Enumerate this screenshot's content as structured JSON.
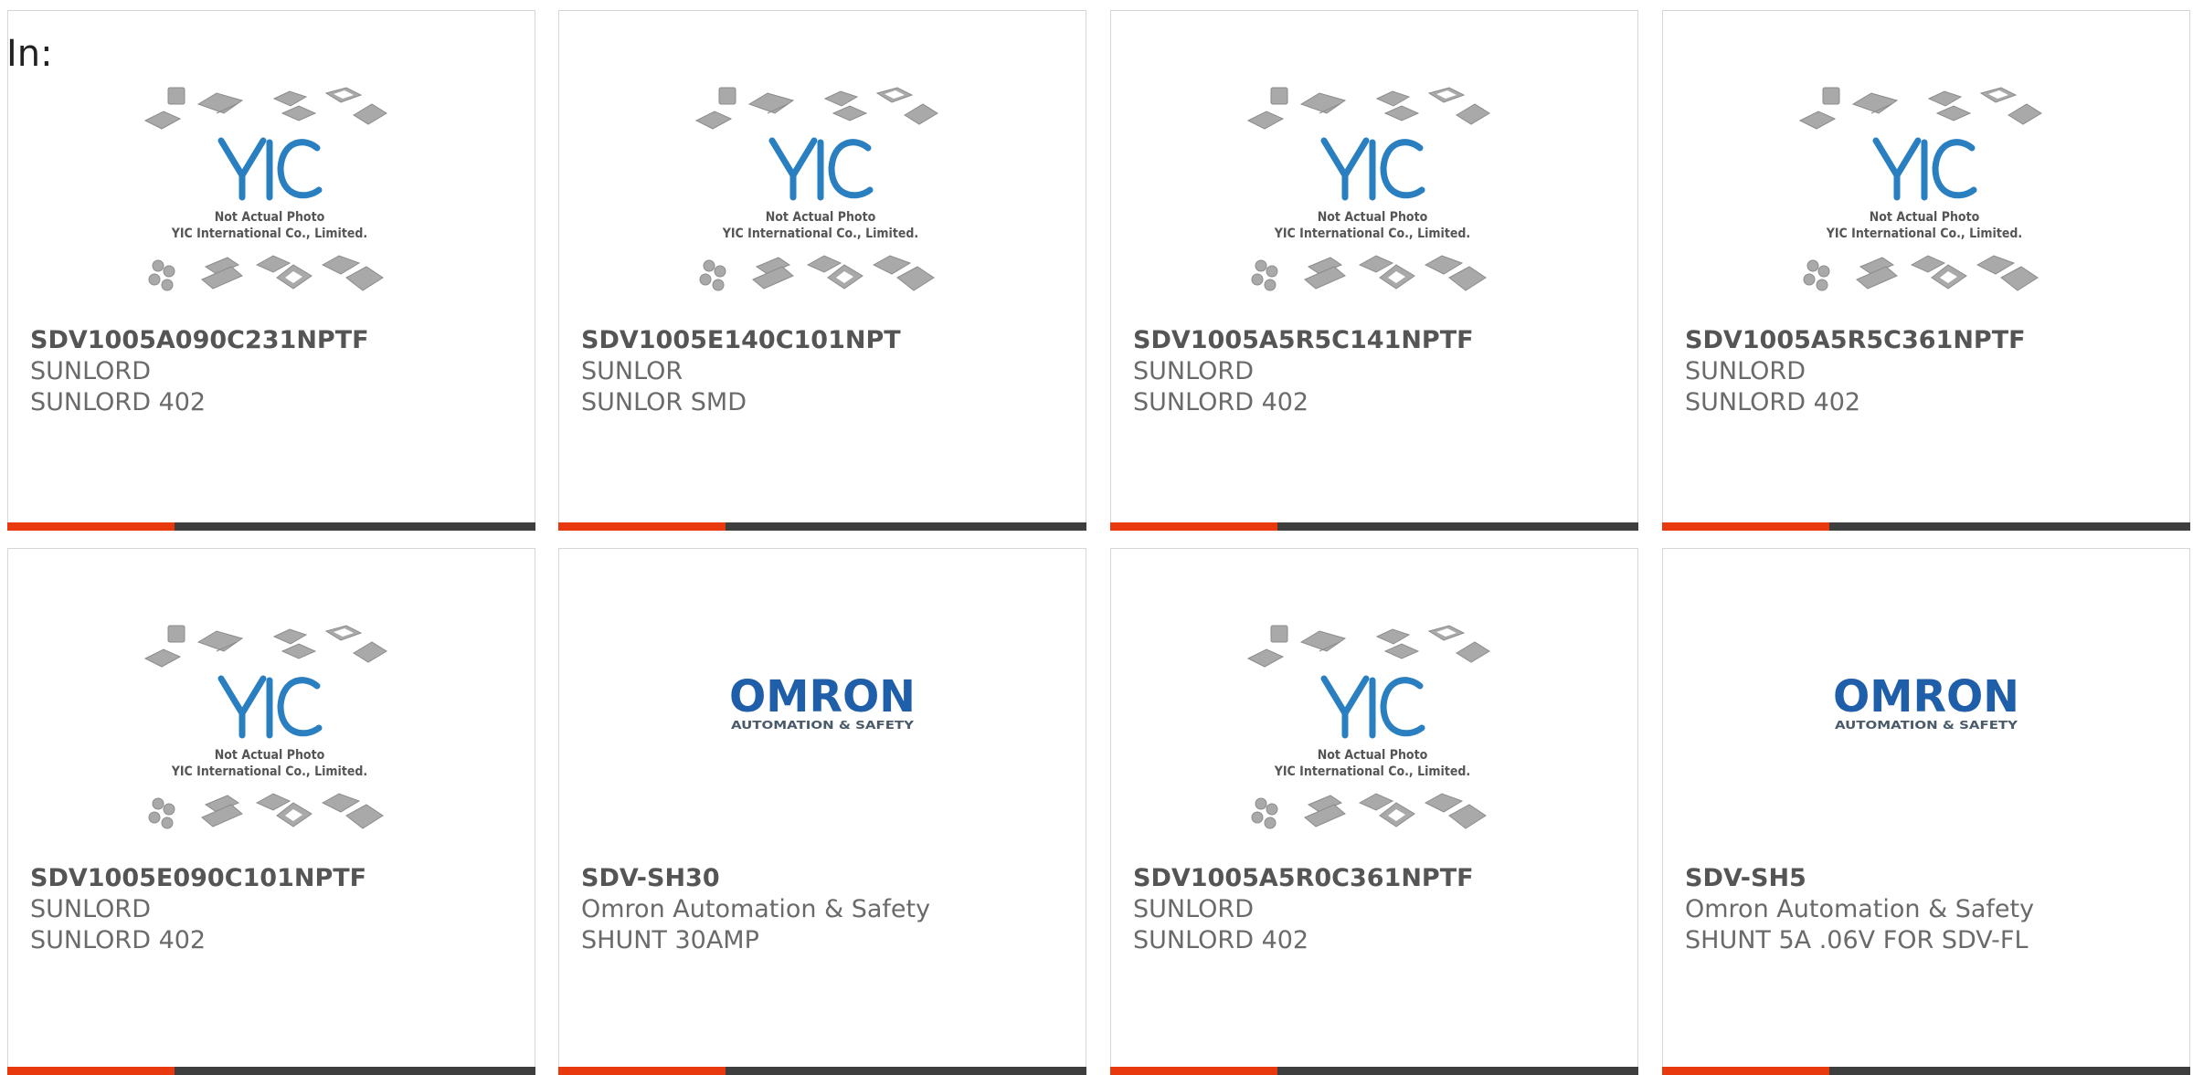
{
  "header": {
    "in_label": "In:"
  },
  "colors": {
    "accent": "#e8380d",
    "bar": "#3e3e3e",
    "yic_blue": "#2a7fc0",
    "omron_blue": "#1f5ea8"
  },
  "cards": [
    {
      "part": "SDV1005A090C231NPTF",
      "manufacturer": "SUNLORD",
      "description": "SUNLORD 402",
      "image": "yic-not-actual-photo",
      "image_text": {
        "line1": "Not Actual Photo",
        "line2": "YIC International Co., Limited.",
        "logo": "YIC"
      }
    },
    {
      "part": "SDV1005E140C101NPT",
      "manufacturer": "SUNLOR",
      "description": "SUNLOR SMD",
      "image": "yic-not-actual-photo",
      "image_text": {
        "line1": "Not Actual Photo",
        "line2": "YIC International Co., Limited.",
        "logo": "YIC"
      }
    },
    {
      "part": "SDV1005A5R5C141NPTF",
      "manufacturer": "SUNLORD",
      "description": "SUNLORD 402",
      "image": "yic-not-actual-photo",
      "image_text": {
        "line1": "Not Actual Photo",
        "line2": "YIC International Co., Limited.",
        "logo": "YIC"
      }
    },
    {
      "part": "SDV1005A5R5C361NPTF",
      "manufacturer": "SUNLORD",
      "description": "SUNLORD 402",
      "image": "yic-not-actual-photo",
      "image_text": {
        "line1": "Not Actual Photo",
        "line2": "YIC International Co., Limited.",
        "logo": "YIC"
      }
    },
    {
      "part": "SDV1005E090C101NPTF",
      "manufacturer": "SUNLORD",
      "description": "SUNLORD 402",
      "image": "yic-not-actual-photo",
      "image_text": {
        "line1": "Not Actual Photo",
        "line2": "YIC International Co., Limited.",
        "logo": "YIC"
      }
    },
    {
      "part": "SDV-SH30",
      "manufacturer": "Omron Automation & Safety",
      "description": "SHUNT 30AMP",
      "image": "omron-logo",
      "image_text": {
        "logo": "OMRON",
        "tagline": "AUTOMATION & SAFETY"
      }
    },
    {
      "part": "SDV1005A5R0C361NPTF",
      "manufacturer": "SUNLORD",
      "description": "SUNLORD 402",
      "image": "yic-not-actual-photo",
      "image_text": {
        "line1": "Not Actual Photo",
        "line2": "YIC International Co., Limited.",
        "logo": "YIC"
      }
    },
    {
      "part": "SDV-SH5",
      "manufacturer": "Omron Automation & Safety",
      "description": "SHUNT 5A .06V FOR SDV-FL",
      "image": "omron-logo",
      "image_text": {
        "logo": "OMRON",
        "tagline": "AUTOMATION & SAFETY"
      }
    }
  ]
}
